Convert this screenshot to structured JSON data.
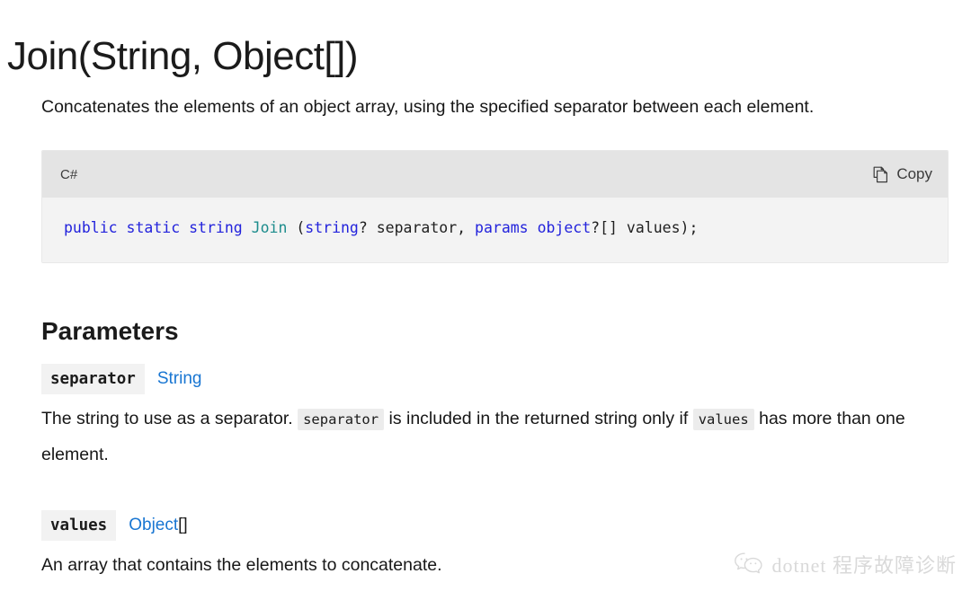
{
  "page": {
    "title": "Join(String, Object[])",
    "summary": "Concatenates the elements of an object array, using the specified separator between each element."
  },
  "code_block": {
    "language": "C#",
    "copy_label": "Copy",
    "copy_icon": "copy-icon",
    "tokens": [
      {
        "text": "public",
        "kind": "keyword"
      },
      {
        "text": " ",
        "kind": "plain"
      },
      {
        "text": "static",
        "kind": "keyword"
      },
      {
        "text": " ",
        "kind": "plain"
      },
      {
        "text": "string",
        "kind": "keyword"
      },
      {
        "text": " ",
        "kind": "plain"
      },
      {
        "text": "Join",
        "kind": "function"
      },
      {
        "text": " (",
        "kind": "plain"
      },
      {
        "text": "string",
        "kind": "keyword"
      },
      {
        "text": "? separator, ",
        "kind": "plain"
      },
      {
        "text": "params",
        "kind": "keyword"
      },
      {
        "text": " ",
        "kind": "plain"
      },
      {
        "text": "object",
        "kind": "keyword"
      },
      {
        "text": "?[] values);",
        "kind": "plain"
      }
    ],
    "full_text": "public static string Join (string? separator, params object?[] values);"
  },
  "parameters": {
    "heading": "Parameters",
    "items": [
      {
        "name": "separator",
        "type": "String",
        "type_suffix": "",
        "description_parts": [
          {
            "text": "The string to use as a separator. ",
            "kind": "text"
          },
          {
            "text": "separator",
            "kind": "code"
          },
          {
            "text": " is included in the returned string only if ",
            "kind": "text"
          },
          {
            "text": "values",
            "kind": "code"
          },
          {
            "text": " has more than one element.",
            "kind": "text"
          }
        ],
        "description_plain": "The string to use as a separator. separator is included in the returned string only if values has more than one element."
      },
      {
        "name": "values",
        "type": "Object",
        "type_suffix": "[]",
        "description_parts": [
          {
            "text": "An array that contains the elements to concatenate.",
            "kind": "text"
          }
        ],
        "description_plain": "An array that contains the elements to concatenate."
      }
    ]
  },
  "watermark": {
    "icon": "wechat-logo-icon",
    "text": "dotnet 程序故障诊断"
  },
  "colors": {
    "link": "#1976d2",
    "keyword": "#2323dc",
    "function": "#1c8c8c",
    "code_header_bg": "#e4e4e4",
    "code_body_bg": "#f3f3f3",
    "badge_bg": "#f2f2f2",
    "inline_code_bg": "#ececec",
    "text": "#171717"
  }
}
